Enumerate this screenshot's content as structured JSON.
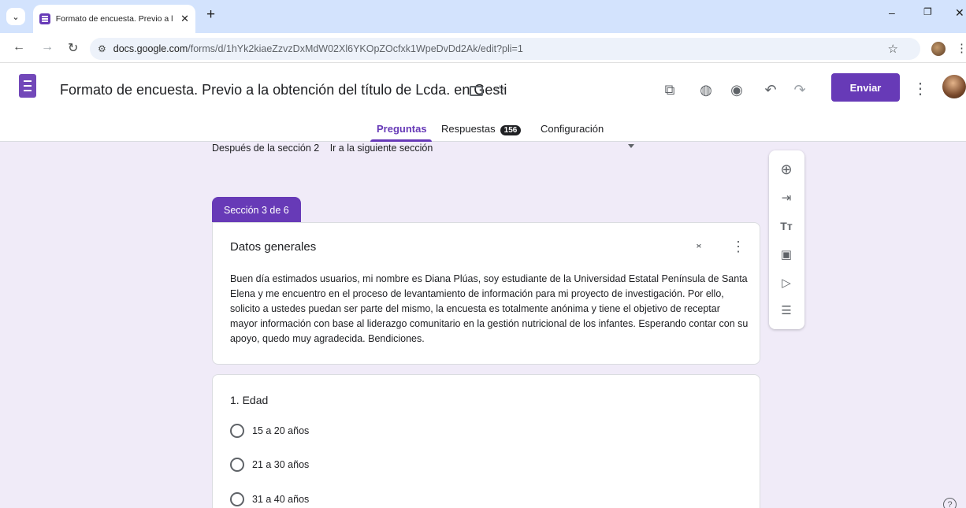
{
  "browser": {
    "tab_title": "Formato de encuesta. Previo a l",
    "url_domain": "docs.google.com",
    "url_path": "/forms/d/1hYk2kiaeZzvzDxMdW02Xl6YKOpZOcfxk1WpeDvDd2Ak/edit?pli=1",
    "icons": [
      "tab-search-icon",
      "form-favicon",
      "close-icon",
      "new-tab-icon",
      "minimize-icon",
      "restore-icon",
      "close-window-icon",
      "back-icon",
      "forward-icon",
      "reload-icon",
      "site-settings-icon",
      "bookmark-star-icon",
      "profile-avatar",
      "chrome-menu-icon"
    ]
  },
  "header": {
    "title": "Formato de encuesta. Previo a la obtención del título de Lcda. en Gesti",
    "send_label": "Enviar",
    "icons": [
      "forms-logo",
      "folder-icon",
      "star-icon",
      "customize-theme-icon",
      "palette-icon",
      "preview-eye-icon",
      "undo-icon",
      "redo-icon",
      "more-vert-icon",
      "user-avatar"
    ]
  },
  "tabs": {
    "questions": "Preguntas",
    "responses": "Respuestas",
    "responses_count": "156",
    "settings": "Configuración"
  },
  "after_section": {
    "label": "Después de la sección 2",
    "value": "Ir a la siguiente sección"
  },
  "section": {
    "tab_label": "Sección 3 de 6",
    "title": "Datos generales",
    "description": "Buen día estimados usuarios, mi nombre es Diana Plúas, soy estudiante de la Universidad Estatal Península de Santa Elena y me encuentro en el proceso de levantamiento de información para mi proyecto de investigación. Por ello, solicito a ustedes puedan ser parte del mismo, la encuesta es totalmente anónima y tiene el objetivo de receptar mayor información con base al liderazgo comunitario en la gestión nutricional de los infantes. Esperando contar con su apoyo, quedo muy agradecida. Bendiciones."
  },
  "question": {
    "title": "1. Edad",
    "options": [
      "15 a 20 años",
      "21 a 30 años",
      "31 a 40 años"
    ]
  },
  "side_panel": {
    "icons": [
      "add-question-icon",
      "import-questions-icon",
      "add-title-icon",
      "add-image-icon",
      "add-video-icon",
      "add-section-icon"
    ]
  },
  "colors": {
    "accent": "#673ab7",
    "background": "#f0ebf8",
    "tabstrip": "#d3e3fd"
  }
}
